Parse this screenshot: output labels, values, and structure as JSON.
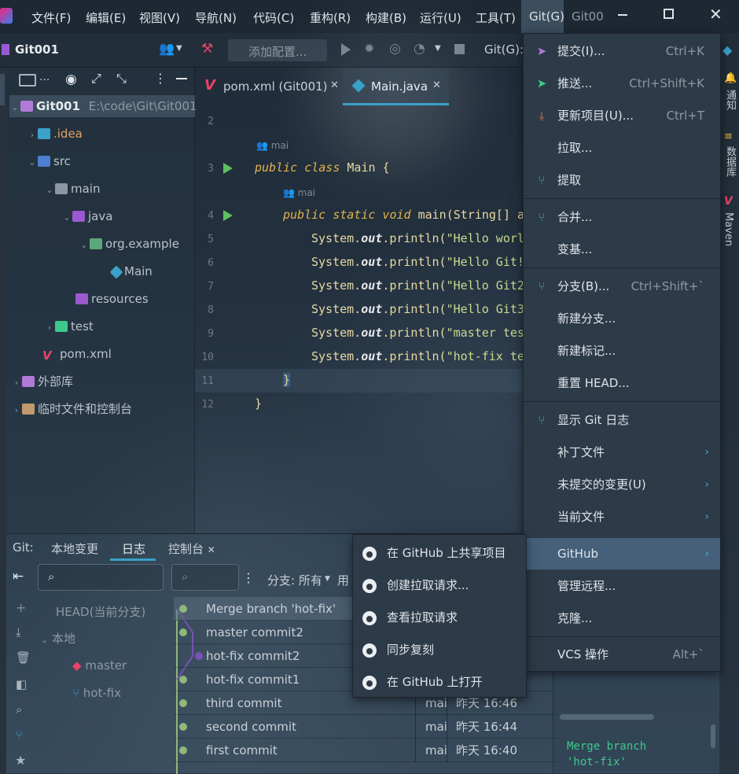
{
  "menubar": {
    "items": [
      "文件(F)",
      "编辑(E)",
      "视图(V)",
      "导航(N)",
      "代码(C)",
      "重构(R)",
      "构建(B)",
      "运行(U)",
      "工具(T)"
    ],
    "git_menu": "Git(G)",
    "window_title": "Git00"
  },
  "toolbar": {
    "project": "Git001",
    "add_config": "添加配置...",
    "git_label": "Git(G):"
  },
  "project_tree": {
    "root_name": "Git001",
    "root_path": "E:\\code\\Git\\Git001",
    "idea": ".idea",
    "src": "src",
    "main": "main",
    "java": "java",
    "package": "org.example",
    "main_class": "Main",
    "resources": "resources",
    "test": "test",
    "pom": "pom.xml",
    "external": "外部库",
    "scratches": "临时文件和控制台"
  },
  "editor": {
    "tabs": [
      {
        "label": "pom.xml (Git001)"
      },
      {
        "label": "Main.java"
      }
    ],
    "author_hint": "mai",
    "line_numbers": [
      "2",
      "3",
      "4",
      "5",
      "6",
      "7",
      "8",
      "9",
      "10",
      "11",
      "12"
    ],
    "code": {
      "class_kw": "public class",
      "class_name": "Main {",
      "method_kw": "public static void",
      "method_sig": "main(String[] a",
      "sys": "System.",
      "out": "out",
      "println": ".println(",
      "s1": "\"Hello worl",
      "s2": "\"Hello Git!",
      "s3": "\"Hello Git2",
      "s4": "\"Hello Git3",
      "s5": "\"master tes",
      "s6": "\"hot-fix te",
      "close_inner": "}",
      "close_outer": "}"
    }
  },
  "git_menu": {
    "items": [
      {
        "label": "提交(I)...",
        "shortcut": "Ctrl+K",
        "icon": "commit-icon"
      },
      {
        "label": "推送...",
        "shortcut": "Ctrl+Shift+K",
        "icon": "push-icon"
      },
      {
        "label": "更新项目(U)...",
        "shortcut": "Ctrl+T",
        "icon": "update-icon"
      },
      {
        "label": "拉取...",
        "shortcut": "",
        "icon": ""
      },
      {
        "label": "提取",
        "shortcut": "",
        "icon": "fetch-icon"
      },
      {
        "label": "合并...",
        "shortcut": "",
        "icon": "merge-icon"
      },
      {
        "label": "变基...",
        "shortcut": "",
        "icon": ""
      },
      {
        "label": "分支(B)...",
        "shortcut": "Ctrl+Shift+`",
        "icon": "branch-icon"
      },
      {
        "label": "新建分支...",
        "shortcut": "",
        "icon": ""
      },
      {
        "label": "新建标记...",
        "shortcut": "",
        "icon": ""
      },
      {
        "label": "重置 HEAD...",
        "shortcut": "",
        "icon": ""
      },
      {
        "label": "显示 Git 日志",
        "shortcut": "",
        "icon": "log-icon"
      },
      {
        "label": "补丁文件",
        "shortcut": "",
        "icon": ""
      },
      {
        "label": "未提交的变更(U)",
        "shortcut": "",
        "icon": ""
      },
      {
        "label": "当前文件",
        "shortcut": "",
        "icon": ""
      },
      {
        "label": "GitHub",
        "shortcut": "",
        "icon": ""
      },
      {
        "label": "管理远程...",
        "shortcut": "",
        "icon": ""
      },
      {
        "label": "克隆...",
        "shortcut": "",
        "icon": ""
      },
      {
        "label": "VCS 操作",
        "shortcut": "Alt+`",
        "icon": ""
      }
    ]
  },
  "github_submenu": {
    "items": [
      "在 GitHub 上共享项目",
      "创建拉取请求...",
      "查看拉取请求",
      "同步复刻",
      "在 GitHub 上打开"
    ]
  },
  "right_strip": {
    "notifications": "通知",
    "database": "数据库",
    "maven": "Maven"
  },
  "bottom": {
    "git_label": "Git:",
    "tabs": [
      "本地变更",
      "日志",
      "控制台"
    ],
    "branch_filter": "分支: 所有",
    "user_filter": "用",
    "branches": {
      "head": "HEAD(当前分支)",
      "local": "本地",
      "master": "master",
      "hotfix": "hot-fix"
    },
    "commits": [
      {
        "msg": "Merge branch 'hot-fix'",
        "author": "",
        "date": ""
      },
      {
        "msg": "master commit2",
        "author": "",
        "date": ""
      },
      {
        "msg": "hot-fix commit2",
        "author": "",
        "date": ""
      },
      {
        "msg": "hot-fix commit1",
        "author": "",
        "date": ""
      },
      {
        "msg": "third commit",
        "author": "mai",
        "date": "昨天 16:46"
      },
      {
        "msg": "second commit",
        "author": "mai",
        "date": "昨天 16:44"
      },
      {
        "msg": "first commit",
        "author": "mai",
        "date": "昨天 16:40"
      }
    ],
    "details_text": "Merge branch 'hot-fix'"
  }
}
